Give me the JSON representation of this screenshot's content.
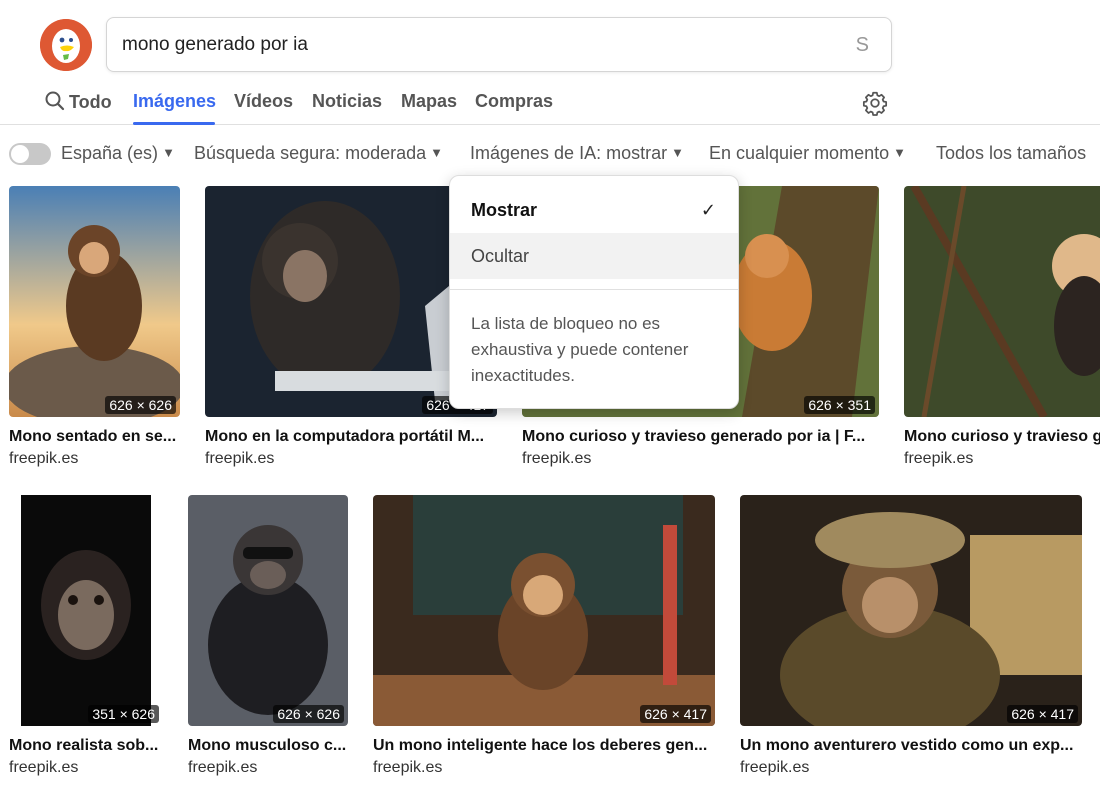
{
  "search": {
    "query": "mono generado por ia",
    "clear_glyph": "S"
  },
  "tabs": [
    {
      "label": "Todo",
      "icon": "search-icon"
    },
    {
      "label": "Imágenes",
      "active": true
    },
    {
      "label": "Vídeos"
    },
    {
      "label": "Noticias"
    },
    {
      "label": "Mapas"
    },
    {
      "label": "Compras"
    }
  ],
  "settings": {
    "icon": "gear-icon"
  },
  "filters": {
    "region_toggle": false,
    "region": "España (es)",
    "safe_search": "Búsqueda segura: moderada",
    "ai_images": "Imágenes de IA: mostrar",
    "time": "En cualquier momento",
    "size": "Todos los tamaños"
  },
  "dropdown": {
    "options": [
      {
        "label": "Mostrar",
        "selected": true
      },
      {
        "label": "Ocultar",
        "selected": false
      }
    ],
    "check_glyph": "✓",
    "note": "La lista de bloqueo no es exhaustiva y puede contener inexactitudes."
  },
  "results": [
    {
      "title": "Mono sentado en se...",
      "source": "freepik.es",
      "dims": "626 × 626"
    },
    {
      "title": "Mono en la computadora portátil M...",
      "source": "freepik.es",
      "dims": "626 × 417"
    },
    {
      "title": "Mono curioso y travieso generado por ia | F...",
      "source": "freepik.es",
      "dims": "626 × 351"
    },
    {
      "title": "Mono curioso y travieso g",
      "source": "freepik.es",
      "dims": ""
    },
    {
      "title": "Mono realista sob...",
      "source": "freepik.es",
      "dims": "351 × 626"
    },
    {
      "title": "Mono musculoso c...",
      "source": "freepik.es",
      "dims": "626 × 626"
    },
    {
      "title": "Un mono inteligente hace los deberes gen...",
      "source": "freepik.es",
      "dims": "626 × 417"
    },
    {
      "title": "Un mono aventurero vestido como un exp...",
      "source": "freepik.es",
      "dims": "626 × 417"
    }
  ],
  "colors": {
    "accent": "#3969ef",
    "logo": "#de5833"
  }
}
